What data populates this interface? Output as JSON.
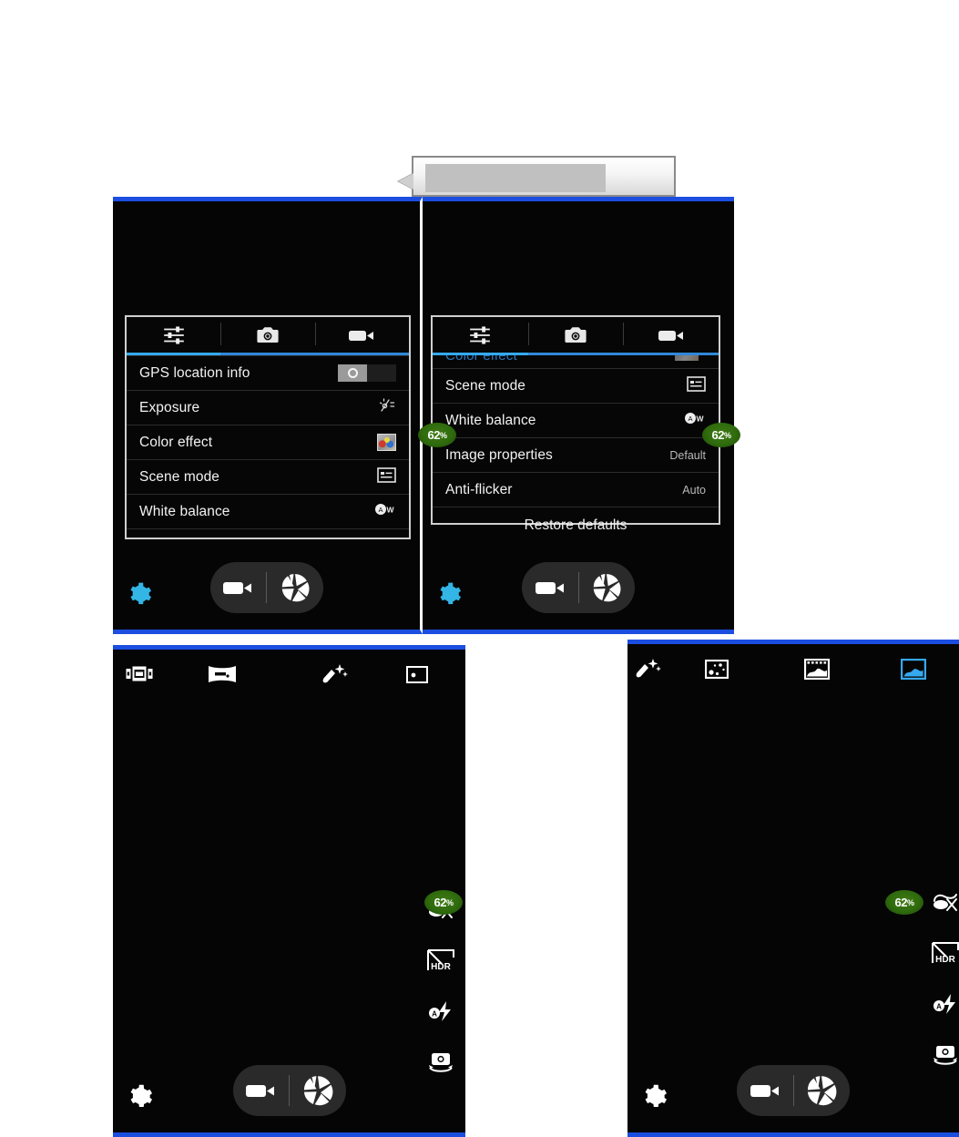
{
  "callout": {
    "name": "tooltip-callout",
    "text": ""
  },
  "battery_badge": {
    "value": "62",
    "unit": "%",
    "color": "#2f6b0d"
  },
  "accent": {
    "panel_border": "#1b4ee0",
    "tab_underline": "#35a9ef",
    "gear_blue": "#33b5e5",
    "gear_white": "#ffffff",
    "mode_active": "#35a9ef"
  },
  "settings_panel_1": {
    "tabs": [
      {
        "label": "General settings",
        "icon": "sliders-icon",
        "active": true
      },
      {
        "label": "Camera settings",
        "icon": "camera-icon",
        "active": false
      },
      {
        "label": "Video settings",
        "icon": "video-icon",
        "active": false
      }
    ],
    "rows": [
      {
        "label": "GPS location info",
        "control": "toggle",
        "value": "off"
      },
      {
        "label": "Exposure",
        "control": "icon",
        "icon": "exposure-icon",
        "value": ""
      },
      {
        "label": "Color effect",
        "control": "icon",
        "icon": "color-effect-thumbnail",
        "value": ""
      },
      {
        "label": "Scene mode",
        "control": "icon",
        "icon": "scene-mode-icon",
        "value": ""
      },
      {
        "label": "White balance",
        "control": "icon",
        "icon": "white-balance-icon",
        "value": ""
      }
    ]
  },
  "settings_panel_2": {
    "tabs": [
      {
        "label": "General settings",
        "icon": "sliders-icon",
        "active": true
      },
      {
        "label": "Camera settings",
        "icon": "camera-icon",
        "active": false
      },
      {
        "label": "Video settings",
        "icon": "video-icon",
        "active": false
      }
    ],
    "scrolled_partial_row": "Color effect",
    "rows": [
      {
        "label": "Scene mode",
        "control": "icon",
        "icon": "scene-mode-icon",
        "value": ""
      },
      {
        "label": "White balance",
        "control": "icon",
        "icon": "white-balance-icon",
        "value": ""
      },
      {
        "label": "Image properties",
        "control": "value",
        "icon": "",
        "value": "Default"
      },
      {
        "label": "Anti-flicker",
        "control": "value",
        "icon": "",
        "value": "Auto"
      }
    ],
    "footer": {
      "label": "Restore defaults"
    }
  },
  "camera_bottom_bar": {
    "gear_label": "Settings",
    "video_label": "Switch to video",
    "shutter_label": "Capture"
  },
  "panel_bottom_left": {
    "modes": [
      {
        "name": "multi-angle-view-icon",
        "active": false
      },
      {
        "name": "panorama-icon",
        "active": false
      },
      {
        "name": "face-beauty-icon",
        "active": false
      },
      {
        "name": "picture-mode-icon",
        "active": false
      }
    ],
    "side_controls": [
      {
        "name": "self-timer-off-icon"
      },
      {
        "name": "hdr-icon"
      },
      {
        "name": "flash-auto-icon"
      },
      {
        "name": "switch-camera-icon"
      }
    ],
    "gear_color": "#ffffff"
  },
  "panel_bottom_right": {
    "modes": [
      {
        "name": "face-beauty-icon",
        "active": false
      },
      {
        "name": "multi-angle-view-icon",
        "active": false
      },
      {
        "name": "live-photo-icon",
        "active": false
      },
      {
        "name": "picture-mode-icon",
        "active": true
      }
    ],
    "side_controls": [
      {
        "name": "self-timer-off-icon"
      },
      {
        "name": "hdr-icon"
      },
      {
        "name": "flash-auto-icon"
      },
      {
        "name": "switch-camera-icon"
      }
    ],
    "gear_color": "#ffffff"
  }
}
